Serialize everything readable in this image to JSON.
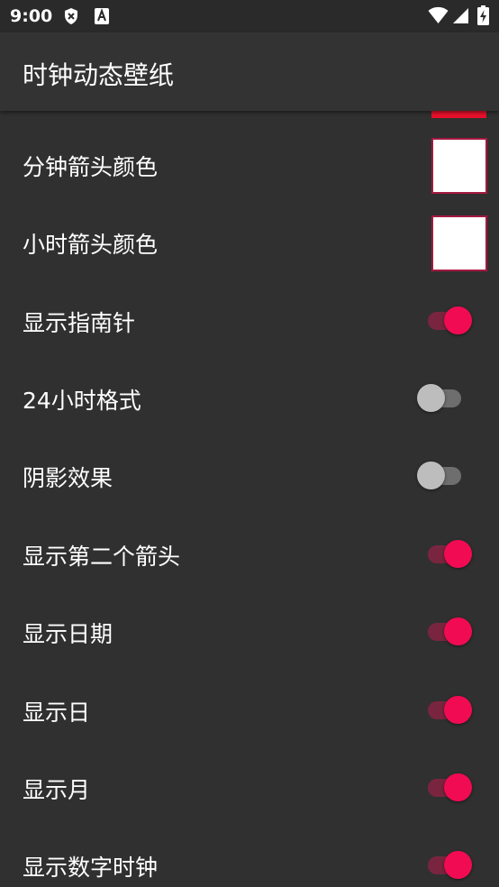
{
  "status_bar": {
    "time": "9:00",
    "left_icons": [
      "shield-x-icon",
      "a-notification-icon"
    ],
    "right_icons": [
      "wifi-icon",
      "cell-signal-icon",
      "battery-charging-icon"
    ]
  },
  "app_bar": {
    "title": "时钟动态壁纸"
  },
  "colors": {
    "accent": "#f10b53",
    "swatch_border": "#a3193f",
    "partial_swatch": "#e8102b",
    "background": "#303030"
  },
  "settings": [
    {
      "label": "分钟箭头颜色",
      "type": "color",
      "value": "#ffffff"
    },
    {
      "label": "小时箭头颜色",
      "type": "color",
      "value": "#ffffff"
    },
    {
      "label": "显示指南针",
      "type": "switch",
      "on": true
    },
    {
      "label": "24小时格式",
      "type": "switch",
      "on": false
    },
    {
      "label": "阴影效果",
      "type": "switch",
      "on": false
    },
    {
      "label": "显示第二个箭头",
      "type": "switch",
      "on": true
    },
    {
      "label": "显示日期",
      "type": "switch",
      "on": true
    },
    {
      "label": "显示日",
      "type": "switch",
      "on": true
    },
    {
      "label": "显示月",
      "type": "switch",
      "on": true
    },
    {
      "label": "显示数字时钟",
      "type": "switch",
      "on": true
    }
  ]
}
